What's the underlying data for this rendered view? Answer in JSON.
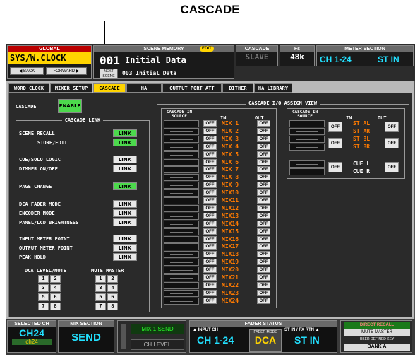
{
  "callout": "CASCADE",
  "header": {
    "global_tag": "GLOBAL",
    "global_value": "SYS/W.CLOCK",
    "back_label": "◀ BACK",
    "forward_label": "FORWARD ▶",
    "scene_memory_title": "SCENE MEMORY",
    "edit_badge": "EDIT",
    "scene_number": "001",
    "scene_name": "Initial Data",
    "next_scene_label": "NEXT SCENE",
    "next_scene_name": "003 Initial Data",
    "cascade_tag": "CASCADE",
    "cascade_value": "SLAVE",
    "fs_tag": "Fs",
    "fs_value": "48k",
    "meter_title": "METER SECTION",
    "meter_ch": "CH 1-24",
    "meter_st": "ST IN"
  },
  "tabs": [
    "WORD CLOCK",
    "MIXER SETUP",
    "CASCADE",
    "HA",
    "OUTPUT PORT ATT",
    "DITHER",
    "HA LIBRARY"
  ],
  "cascade": {
    "label": "CASCADE",
    "enable_label": "ENABLE",
    "link_title": "CASCADE LINK",
    "link_rows": [
      {
        "label": "SCENE RECALL",
        "btn": "LINK",
        "on": true
      },
      {
        "label": "STORE/EDIT",
        "btn": "LINK",
        "on": true
      },
      {
        "label": "CUE/SOLO LOGIC",
        "btn": "LINK",
        "on": false
      },
      {
        "label": "DIMMER ON/OFF",
        "btn": "LINK",
        "on": false
      },
      {
        "label": "PAGE CHANGE",
        "btn": "LINK",
        "on": true
      },
      {
        "label": "DCA FADER MODE",
        "btn": "LINK",
        "on": false
      },
      {
        "label": "ENCODER MODE",
        "btn": "LINK",
        "on": false
      },
      {
        "label": "PANEL/LCD BRIGHTNESS",
        "btn": "LINK",
        "on": false
      },
      {
        "label": "INPUT METER POINT",
        "btn": "LINK",
        "on": false
      },
      {
        "label": "OUTPUT METER POINT",
        "btn": "LINK",
        "on": false
      },
      {
        "label": "PEAK HOLD",
        "btn": "LINK",
        "on": false
      }
    ],
    "dca_label": "DCA LEVEL/MUTE",
    "mute_label": "MUTE MASTER",
    "numbers": [
      "1",
      "2",
      "3",
      "4",
      "5",
      "6",
      "7",
      "8"
    ]
  },
  "io_view": {
    "title": "CASCADE I/O ASSIGN VIEW",
    "source_label": "CASCADE IN SOURCE",
    "in_label": "IN",
    "out_label": "OUT",
    "off_label": "OFF",
    "mixes": [
      "MIX 1",
      "MIX 2",
      "MIX 3",
      "MIX 4",
      "MIX 5",
      "MIX 6",
      "MIX 7",
      "MIX 8",
      "MIX 9",
      "MIX10",
      "MIX11",
      "MIX12",
      "MIX13",
      "MIX14",
      "MIX15",
      "MIX16",
      "MIX17",
      "MIX18",
      "MIX19",
      "MIX20",
      "MIX21",
      "MIX22",
      "MIX23",
      "MIX24"
    ],
    "st_labels": [
      "ST AL",
      "ST AR",
      "ST BL",
      "ST BR"
    ],
    "cue_labels": [
      "CUE L",
      "CUE R"
    ]
  },
  "footer": {
    "selected_ch_tag": "SELECTED CH",
    "selected_ch": "CH24",
    "selected_ch_sub": "ch24",
    "mix_section_tag": "MIX SECTION",
    "mix_section": "SEND",
    "mix_send": "MIX 1 SEND",
    "ch_level": "CH LEVEL",
    "fader_status_tag": "FADER STATUS",
    "input_ch_tag": "▲ INPUT CH",
    "input_ch": "CH 1-24",
    "fader_mode_tag": "FADER MODE",
    "fader_mode": "DCA",
    "st_in_tag": "ST IN / FX RTN ▲",
    "st_in": "ST IN",
    "direct_recall": "DIRECT RECALL",
    "mute_master": "MUTE MASTER",
    "user_key_tag": "USER DEFINED KEY",
    "bank": "BANK A"
  },
  "colors": {
    "accent_yellow": "#ffd400",
    "link_on": "#4cd94c",
    "mix_orange": "#ff7a00",
    "st_orange": "#ff7a00",
    "cyan": "#22e0ff"
  }
}
